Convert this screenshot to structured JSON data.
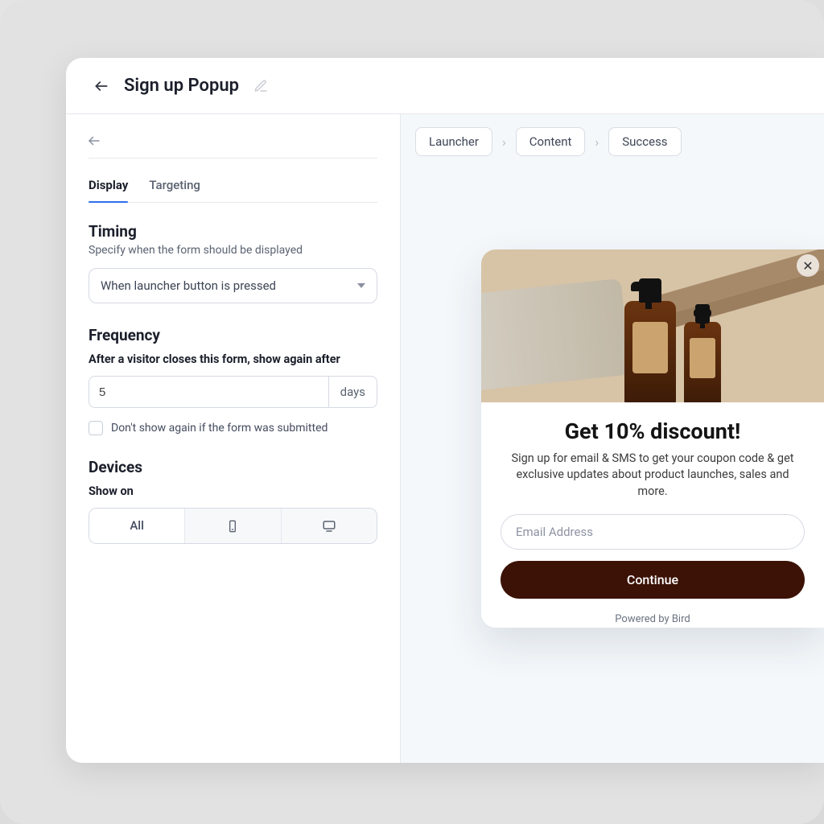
{
  "header": {
    "title": "Sign up Popup"
  },
  "sidebar": {
    "tabs": {
      "display": "Display",
      "targeting": "Targeting"
    },
    "timing": {
      "title": "Timing",
      "subtitle": "Specify when the form should be displayed",
      "select_value": "When launcher button is pressed"
    },
    "frequency": {
      "title": "Frequency",
      "subtitle": "After a visitor closes this form, show again after",
      "value": "5",
      "unit": "days",
      "checkbox_label": "Don't show again if the form was submitted"
    },
    "devices": {
      "title": "Devices",
      "subtitle": "Show on",
      "all_label": "All"
    }
  },
  "crumbs": {
    "launcher": "Launcher",
    "content": "Content",
    "success": "Success"
  },
  "popup": {
    "title": "Get 10% discount!",
    "desc": "Sign up for email & SMS to get your coupon code & get exclusive updates about product launches, sales and more.",
    "email_placeholder": "Email Address",
    "button": "Continue",
    "powered_by": "Powered by Bird"
  }
}
